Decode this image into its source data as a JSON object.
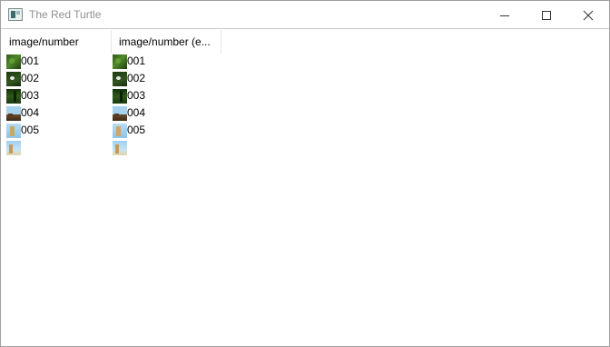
{
  "window": {
    "title": "The Red Turtle"
  },
  "table": {
    "columns": [
      {
        "label": "image/number"
      },
      {
        "label": "image/number (e..."
      }
    ],
    "rows": [
      {
        "c1_icon": "forest-thumbnail",
        "c1_text": "001",
        "c2_icon": "forest-thumbnail",
        "c2_text": "001"
      },
      {
        "c1_icon": "dark-forest-thumbnail",
        "c1_text": "002",
        "c2_icon": "dark-forest-thumbnail",
        "c2_text": "002"
      },
      {
        "c1_icon": "jungle-thumbnail",
        "c1_text": "003",
        "c2_icon": "jungle-thumbnail",
        "c2_text": "003"
      },
      {
        "c1_icon": "coast-thumbnail",
        "c1_text": "004",
        "c2_icon": "coast-thumbnail",
        "c2_text": "004"
      },
      {
        "c1_icon": "cliff-thumbnail",
        "c1_text": "005",
        "c2_icon": "cliff-thumbnail",
        "c2_text": "005"
      },
      {
        "c1_icon": "beach-thumbnail",
        "c1_text": "",
        "c2_icon": "beach-thumbnail",
        "c2_text": ""
      }
    ]
  },
  "colors": {
    "title_text": "#909090",
    "window_border": "#a0a0a0",
    "background": "#ffffff"
  }
}
